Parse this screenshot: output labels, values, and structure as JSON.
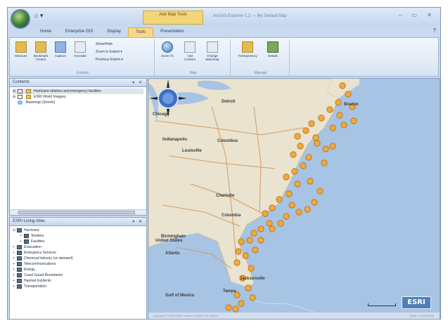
{
  "titlebar": {
    "qat_label": "⌂ ▾",
    "context_tab": "Add Map Tools",
    "window_title": "ArcGIS Explorer 1.2 — My Default Map",
    "controls": "– ▭ ✕"
  },
  "ribbon_tabs": [
    {
      "label": "Home",
      "active": false
    },
    {
      "label": "Enterprise GIS",
      "active": false
    },
    {
      "label": "Display",
      "active": false
    },
    {
      "label": "Tools",
      "active": true
    },
    {
      "label": "Presentation",
      "active": false
    }
  ],
  "ribbon_help": "?",
  "ribbon": {
    "groups": [
      {
        "label": "Explore"
      },
      {
        "label": "Map"
      },
      {
        "label": "Manage"
      }
    ],
    "buttons": {
      "measure": "Measure",
      "bookmark": "Bookmark Creator",
      "capture": "Capture",
      "annotate": "Annotate",
      "zoom_to": "Zoom To",
      "add_content": "Add Content",
      "basemap": "Change Basemap",
      "transparency": "Transparency",
      "details": "Details"
    },
    "small": {
      "row1": "Show/Hide",
      "row2": "Zoom to Extent ▾",
      "row3": "Previous Extent ▾"
    },
    "icons": {
      "measure": "ruler-icon",
      "bookmark": "bookmark-icon",
      "capture": "camera-icon",
      "annotate": "note-icon",
      "zoom_to": "globe-icon",
      "add_content": "pushpin-icon",
      "basemap": "layers-icon",
      "transparency": "transparency-icon",
      "details": "details-icon"
    }
  },
  "contents_panel": {
    "title": "Contents",
    "controls": "▾ ✕",
    "items": [
      {
        "label": "Hurricane shelters and emergency facilities",
        "expand": "⊞",
        "icon": "layer",
        "selected": true
      },
      {
        "label": "ESRI World Imagery",
        "expand": "⊞",
        "icon": "layer",
        "selected": false
      },
      {
        "label": "Basemap (Streets)",
        "expand": "",
        "icon": "globe",
        "selected": false
      }
    ]
  },
  "catalog_panel": {
    "title": "ESRI Living Atlas",
    "controls": "▾ ✕",
    "items": [
      {
        "label": "Hurricane",
        "indent": 0,
        "expand": "⊟"
      },
      {
        "label": "Shelters",
        "indent": 1,
        "expand": "+"
      },
      {
        "label": "Facilities",
        "indent": 1,
        "expand": "+"
      },
      {
        "label": "Evacuation",
        "indent": 0,
        "expand": "+"
      },
      {
        "label": "Emergency Services",
        "indent": 0,
        "expand": "+"
      },
      {
        "label": "Chemical Industry (on demand)",
        "indent": 0,
        "expand": "+"
      },
      {
        "label": "Telecommunications",
        "indent": 0,
        "expand": "+"
      },
      {
        "label": "Energy",
        "indent": 0,
        "expand": "+"
      },
      {
        "label": "Coast Guard Boundaries",
        "indent": 0,
        "expand": "+"
      },
      {
        "label": "Hazmat Incidents",
        "indent": 0,
        "expand": "+"
      },
      {
        "label": "Transportation",
        "indent": 0,
        "expand": "+"
      }
    ]
  },
  "map": {
    "cities": [
      {
        "label": "Boston"
      },
      {
        "label": "Detroit"
      },
      {
        "label": "Chicago"
      },
      {
        "label": "Indianapolis"
      },
      {
        "label": "Columbus"
      },
      {
        "label": "Louisville"
      },
      {
        "label": "Charlotte"
      },
      {
        "label": "Columbia"
      },
      {
        "label": "Birmingham"
      },
      {
        "label": "Atlanta"
      },
      {
        "label": "United States"
      },
      {
        "label": "Jacksonville"
      },
      {
        "label": "Tampa"
      },
      {
        "label": "Gulf of Mexico"
      }
    ],
    "logo": "ESRI",
    "status_left": "Copyright © 2009 ESRI, i-cubed, USDA FSA, USGS",
    "status_right": "Scale 1:10,000,000",
    "marker_color": "#f2a93b",
    "water_color": "#a7c4e4",
    "land_color": "#e9e3cf"
  }
}
